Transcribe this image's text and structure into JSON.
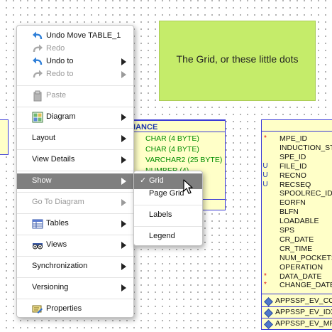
{
  "note": {
    "text": "The Grid, or these little dots"
  },
  "tables": {
    "left_stub": {},
    "middle": {
      "title": "PLIANCE",
      "types": [
        "CHAR (4 BYTE)",
        "CHAR (4 BYTE)",
        "VARCHAR2 (25 BYTE)",
        "NUMBER (4)"
      ]
    },
    "right": {
      "columns": [
        {
          "flag": "*",
          "name": "MPE_ID"
        },
        {
          "flag": "",
          "name": "INDUCTION_STA"
        },
        {
          "flag": "",
          "name": "SPE_ID"
        },
        {
          "flag": "U",
          "name": "FILE_ID"
        },
        {
          "flag": "U",
          "name": "RECNO"
        },
        {
          "flag": "U",
          "name": "RECSEQ"
        },
        {
          "flag": "",
          "name": "SPOOLREC_ID"
        },
        {
          "flag": "",
          "name": "EORFN"
        },
        {
          "flag": "",
          "name": "BLFN"
        },
        {
          "flag": "",
          "name": "LOADABLE"
        },
        {
          "flag": "",
          "name": "SPS"
        },
        {
          "flag": "",
          "name": "CR_DATE"
        },
        {
          "flag": "",
          "name": "CR_TIME"
        },
        {
          "flag": "",
          "name": "NUM_POCKETS"
        },
        {
          "flag": "",
          "name": "OPERATION"
        },
        {
          "flag": "*",
          "name": "DATA_DATE"
        },
        {
          "flag": "*",
          "name": "CHANGE_DATE"
        }
      ],
      "keys": [
        "APPSSP_EV_CON_",
        "APPSSP_EV_IDX_F",
        "APPSSP_EV_MPID"
      ]
    }
  },
  "context_menu": {
    "items": [
      {
        "label": "Undo Move TABLE_1",
        "icon": "undo-icon",
        "disabled": false,
        "submenu": false
      },
      {
        "label": "Redo",
        "icon": "redo-icon",
        "disabled": true,
        "submenu": false
      },
      {
        "label": "Undo to",
        "icon": "undo-icon",
        "disabled": false,
        "submenu": true
      },
      {
        "label": "Redo to",
        "icon": "redo-icon",
        "disabled": true,
        "submenu": true
      },
      {
        "label": "Paste",
        "icon": "paste-icon",
        "disabled": true,
        "submenu": false
      },
      {
        "label": "Diagram",
        "icon": "diagram-icon",
        "disabled": false,
        "submenu": true
      },
      {
        "label": "Layout",
        "disabled": false,
        "submenu": true
      },
      {
        "label": "View Details",
        "disabled": false,
        "submenu": true
      },
      {
        "label": "Show",
        "disabled": false,
        "submenu": true,
        "highlighted": true
      },
      {
        "label": "Go To Diagram",
        "disabled": true,
        "submenu": true
      },
      {
        "label": "Tables",
        "icon": "table-icon",
        "disabled": false,
        "submenu": true
      },
      {
        "label": "Views",
        "icon": "views-icon",
        "disabled": false,
        "submenu": true
      },
      {
        "label": "Synchronization",
        "disabled": false,
        "submenu": true
      },
      {
        "label": "Versioning",
        "disabled": false,
        "submenu": true
      },
      {
        "label": "Properties",
        "icon": "properties-icon",
        "disabled": false,
        "submenu": false
      }
    ]
  },
  "show_submenu": {
    "items": [
      {
        "label": "Grid",
        "checked": true,
        "highlighted": true
      },
      {
        "label": "Page Grid",
        "checked": false
      },
      {
        "label": "Labels",
        "checked": false
      },
      {
        "label": "Legend",
        "checked": false
      }
    ]
  },
  "colors": {
    "note_bg": "#c5ec6a",
    "table_bg": "#ffffc8",
    "table_border": "#3b3bd6",
    "menu_highlight": "#7f7f7f",
    "type_text": "#008c00"
  }
}
